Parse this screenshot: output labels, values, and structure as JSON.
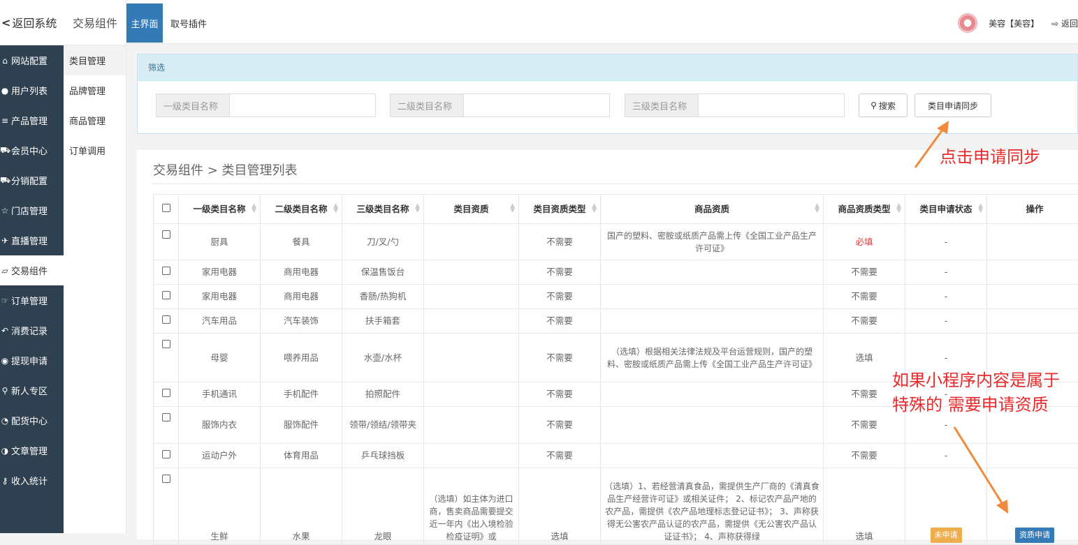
{
  "sidebar": {
    "back_label": "返回系统",
    "items": [
      {
        "icon": "home-icon",
        "label": "网站配置"
      },
      {
        "icon": "user-icon",
        "label": "用户列表"
      },
      {
        "icon": "list-icon",
        "label": "产品管理"
      },
      {
        "icon": "cart-icon",
        "label": "会员中心"
      },
      {
        "icon": "cart-icon",
        "label": "分销配置"
      },
      {
        "icon": "star-icon",
        "label": "门店管理"
      },
      {
        "icon": "plane-icon",
        "label": "直播管理"
      },
      {
        "icon": "eraser-icon",
        "label": "交易组件"
      },
      {
        "icon": "hand-icon",
        "label": "订单管理"
      },
      {
        "icon": "reply-icon",
        "label": "消费记录"
      },
      {
        "icon": "wechat-icon",
        "label": "提现申请"
      },
      {
        "icon": "pin-icon",
        "label": "新人专区"
      },
      {
        "icon": "pie-icon",
        "label": "配货中心"
      },
      {
        "icon": "adjust-icon",
        "label": "文章管理"
      },
      {
        "icon": "key-icon",
        "label": "收入统计"
      }
    ]
  },
  "subnav": {
    "title": "交易组件",
    "items": [
      "类目管理",
      "品牌管理",
      "商品管理",
      "订单调用"
    ]
  },
  "topbar": {
    "tabs": [
      "主界面",
      "取号插件"
    ],
    "user_name": "美容【美容】",
    "logout_label": "返回"
  },
  "filter": {
    "heading": "筛选",
    "placeholders": [
      "一级类目名称",
      "二级类目名称",
      "三级类目名称"
    ],
    "search_label": "搜索",
    "sync_label": "类目申请同步"
  },
  "list": {
    "breadcrumb": "交易组件 > 类目管理列表",
    "columns": [
      "一级类目名称",
      "二级类目名称",
      "三级类目名称",
      "类目资质",
      "类目资质类型",
      "商品资质",
      "商品资质类型",
      "类目申请状态",
      "操作"
    ],
    "rows": [
      {
        "c1": "厨具",
        "c2": "餐具",
        "c3": "刀/叉/勺",
        "qual": "",
        "qual_type": "不需要",
        "goods_qual": "国产的塑料、密胺或纸质产品需上传《全国工业产品生产许可证》",
        "goods_type": "必填",
        "status": "-",
        "op": ""
      },
      {
        "c1": "家用电器",
        "c2": "商用电器",
        "c3": "保温售饭台",
        "qual": "",
        "qual_type": "不需要",
        "goods_qual": "",
        "goods_type": "不需要",
        "status": "-",
        "op": ""
      },
      {
        "c1": "家用电器",
        "c2": "商用电器",
        "c3": "香肠/热狗机",
        "qual": "",
        "qual_type": "不需要",
        "goods_qual": "",
        "goods_type": "不需要",
        "status": "-",
        "op": ""
      },
      {
        "c1": "汽车用品",
        "c2": "汽车装饰",
        "c3": "扶手箱套",
        "qual": "",
        "qual_type": "不需要",
        "goods_qual": "",
        "goods_type": "不需要",
        "status": "-",
        "op": ""
      },
      {
        "c1": "母婴",
        "c2": "喂养用品",
        "c3": "水壶/水杯",
        "qual": "",
        "qual_type": "不需要",
        "goods_qual": "（选填）根据相关法律法规及平台运营规则，国产的塑料、密胺或纸质产品需上传《全国工业产品生产许可证》",
        "goods_type": "选填",
        "status": "-",
        "op": ""
      },
      {
        "c1": "手机通讯",
        "c2": "手机配件",
        "c3": "拍照配件",
        "qual": "",
        "qual_type": "不需要",
        "goods_qual": "",
        "goods_type": "不需要",
        "status": "-",
        "op": ""
      },
      {
        "c1": "服饰内衣",
        "c2": "服饰配件",
        "c3": "领带/领结/领带夹",
        "qual": "",
        "qual_type": "不需要",
        "goods_qual": "",
        "goods_type": "不需要",
        "status": "-",
        "op": ""
      },
      {
        "c1": "运动户外",
        "c2": "体育用品",
        "c3": "乒乓球挡板",
        "qual": "",
        "qual_type": "不需要",
        "goods_qual": "",
        "goods_type": "不需要",
        "status": "-",
        "op": ""
      },
      {
        "c1": "生鲜",
        "c2": "水果",
        "c3": "龙眼",
        "qual": "（选填）如主体为进口商，售卖商品需要提交近一年内《出入境检验检疫证明》或",
        "qual_type": "选填",
        "goods_qual": "（选填）1、若经营清真食品，需提供生产厂商的《清真食品生产经营许可证》或相关证件； 2、标记农产品产地的农产品，需提供《农产品地理标志登记证书》； 3、声称获得无公害农产品认证的农产品，需提供《无公害农产品认证证书》； 4、声称获得绿",
        "goods_type": "选填",
        "status": "未申请",
        "op": "资质申请"
      }
    ]
  },
  "annotations": {
    "sync_hint": "点击申请同步",
    "special_hint": "如果小程序内容是属于特殊的  需要申请资质"
  },
  "colors": {
    "accent": "#337ab7",
    "sidebar_bg": "#2f4050",
    "annotation": "#ea2a2a",
    "arrow": "#f08a3c"
  }
}
